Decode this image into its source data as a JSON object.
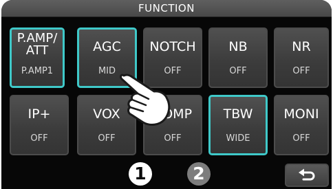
{
  "title": "FUNCTION",
  "row1": [
    {
      "label": "P.AMP/\nATT",
      "value": "P.AMP1"
    },
    {
      "label": "AGC",
      "value": "MID"
    },
    {
      "label": "NOTCH",
      "value": "OFF"
    },
    {
      "label": "NB",
      "value": "OFF"
    },
    {
      "label": "NR",
      "value": "OFF"
    }
  ],
  "row2": [
    {
      "label": "IP+",
      "value": "OFF"
    },
    {
      "label": "VOX",
      "value": "OFF"
    },
    {
      "label": "COMP",
      "value": "OFF"
    },
    {
      "label": "TBW",
      "value": "WIDE"
    },
    {
      "label": "MONI",
      "value": "OFF"
    }
  ],
  "pages": {
    "first": "1",
    "second": "2"
  },
  "back_icon": "return-arrow-icon",
  "pointer_icon": "pointing-hand-icon",
  "colors": {
    "accent": "#3fc9c9",
    "background": "#070707"
  }
}
